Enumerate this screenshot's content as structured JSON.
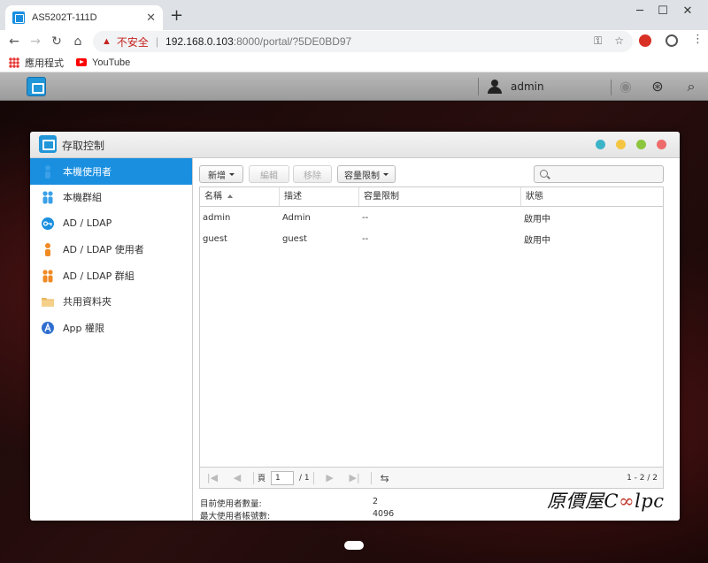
{
  "browser": {
    "tab_title": "AS5202T-111D",
    "insecure_label": "不安全",
    "url_host": "192.168.0.103",
    "url_rest": ":8000/portal/?5DE0BD97",
    "bookmarks": [
      "應用程式",
      "YouTube"
    ]
  },
  "adm_bar": {
    "username": "admin"
  },
  "window": {
    "title": "存取控制",
    "traffic_colors": [
      "#3cb4c8",
      "#f4c542",
      "#8cc63f",
      "#ee6b6b"
    ]
  },
  "sidebar": {
    "items": [
      {
        "label": "本機使用者",
        "icon": "user-icon",
        "color": "#3aa0e8"
      },
      {
        "label": "本機群組",
        "icon": "group-icon",
        "color": "#3aa0e8"
      },
      {
        "label": "AD / LDAP",
        "icon": "key-icon",
        "color": "#1a8fe0"
      },
      {
        "label": "AD / LDAP 使用者",
        "icon": "user-icon",
        "color": "#f08a24"
      },
      {
        "label": "AD / LDAP 群組",
        "icon": "group-icon",
        "color": "#f08a24"
      },
      {
        "label": "共用資料夾",
        "icon": "folder-icon",
        "color": "#e8b860"
      },
      {
        "label": "App 權限",
        "icon": "app-icon",
        "color": "#2f6fcf"
      }
    ]
  },
  "toolbar": {
    "add": "新增",
    "edit": "編輯",
    "remove": "移除",
    "quota": "容量限制"
  },
  "table": {
    "headers": [
      "名稱",
      "描述",
      "容量限制",
      "狀態"
    ],
    "rows": [
      [
        "admin",
        "Admin",
        "--",
        "啟用中"
      ],
      [
        "guest",
        "guest",
        "--",
        "啟用中"
      ]
    ]
  },
  "pager": {
    "page_label": "頁",
    "page_value": "1",
    "total_pages": "/ 1",
    "range": "1 - 2 / 2"
  },
  "summary": {
    "current_label": "目前使用者數量:",
    "current_value": "2",
    "max_label": "最大使用者帳號數:",
    "max_value": "4096"
  },
  "watermark": {
    "text_pre": "原價屋C",
    "text_inf": "∞",
    "text_post": "lpc"
  }
}
